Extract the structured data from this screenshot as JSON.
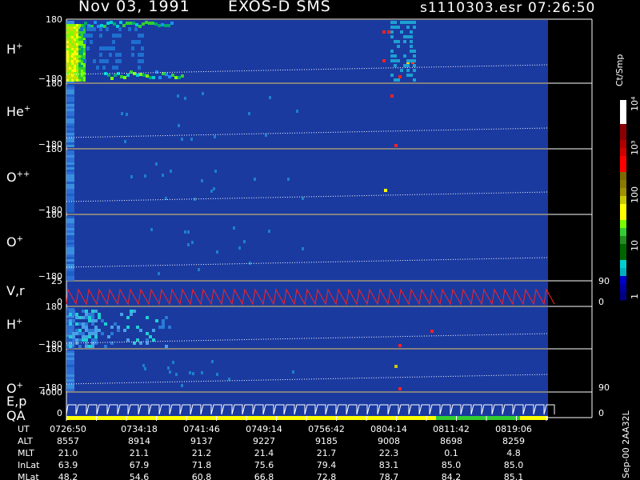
{
  "header": {
    "date": "Nov 03, 1991",
    "instrument": "EXOS-D SMS",
    "file": "s1110303.esr",
    "start_time": "07:26:50"
  },
  "panels": [
    {
      "label": "H",
      "sup": "+",
      "top": "180",
      "bottom": "−180"
    },
    {
      "label": "He",
      "sup": "+",
      "top": "180",
      "bottom": "−180"
    },
    {
      "label": "O",
      "sup": "++",
      "top": "180",
      "bottom": "−180"
    },
    {
      "label": "O",
      "sup": "+",
      "top": "180",
      "bottom": "−180"
    },
    {
      "label": "V,r",
      "sup": "",
      "top": "25",
      "bottom": "0",
      "right_top": "90",
      "right_bottom": "0"
    },
    {
      "label": "H",
      "sup": "+",
      "top": "180",
      "bottom": "−180"
    },
    {
      "label": "O",
      "sup": "+",
      "top": "180",
      "bottom": "−180",
      "right_bottom": "90"
    },
    {
      "label": "E,p",
      "sup": "",
      "label2": "QA",
      "top": "4000",
      "bottom": "0",
      "right_bottom": "0"
    }
  ],
  "colorbar": {
    "title": "Ct/Smp",
    "ticks": [
      "10⁴",
      "10³",
      "100",
      "10",
      "1"
    ],
    "colors": [
      "#ffffff",
      "#ffffff",
      "#ffffff",
      "#8b0000",
      "#8b0000",
      "#b00000",
      "#d00000",
      "#ff0000",
      "#ff0000",
      "#7a6a00",
      "#8a7a00",
      "#a09000",
      "#c8c800",
      "#ffff00",
      "#ffff00",
      "#7cfc00",
      "#32cd32",
      "#228b22",
      "#006400",
      "#006400",
      "#00ced1",
      "#00b0c0",
      "#0000cd",
      "#0000a0",
      "#000080"
    ]
  },
  "chart_data": {
    "type": "heatmap",
    "times": {
      "UT": [
        "0726:50",
        "0734:18",
        "0741:46",
        "0749:14",
        "0756:42",
        "0804:14",
        "0811:42",
        "0819:06"
      ],
      "ALT": [
        "8557",
        "8914",
        "9137",
        "9227",
        "9185",
        "9008",
        "8698",
        "8259"
      ],
      "MLT": [
        "21.0",
        "21.1",
        "21.2",
        "21.4",
        "21.7",
        "22.3",
        "0.1",
        "4.8"
      ],
      "InLat": [
        "63.9",
        "67.9",
        "71.8",
        "75.6",
        "79.4",
        "83.1",
        "85.0",
        "85.0"
      ],
      "MLat": [
        "48.2",
        "54.6",
        "60.8",
        "66.8",
        "72.8",
        "78.7",
        "84.2",
        "85.1"
      ]
    },
    "row_labels": [
      "UT",
      "ALT",
      "MLT",
      "InLat",
      "MLat"
    ],
    "yrange_pitch": [
      -180,
      180
    ],
    "yrange_velocity": [
      0,
      25
    ],
    "yrange_energy": [
      0,
      4000
    ],
    "background_color": "#1a3aa0",
    "sidebar_note": "Sep-00 2AA32L"
  }
}
